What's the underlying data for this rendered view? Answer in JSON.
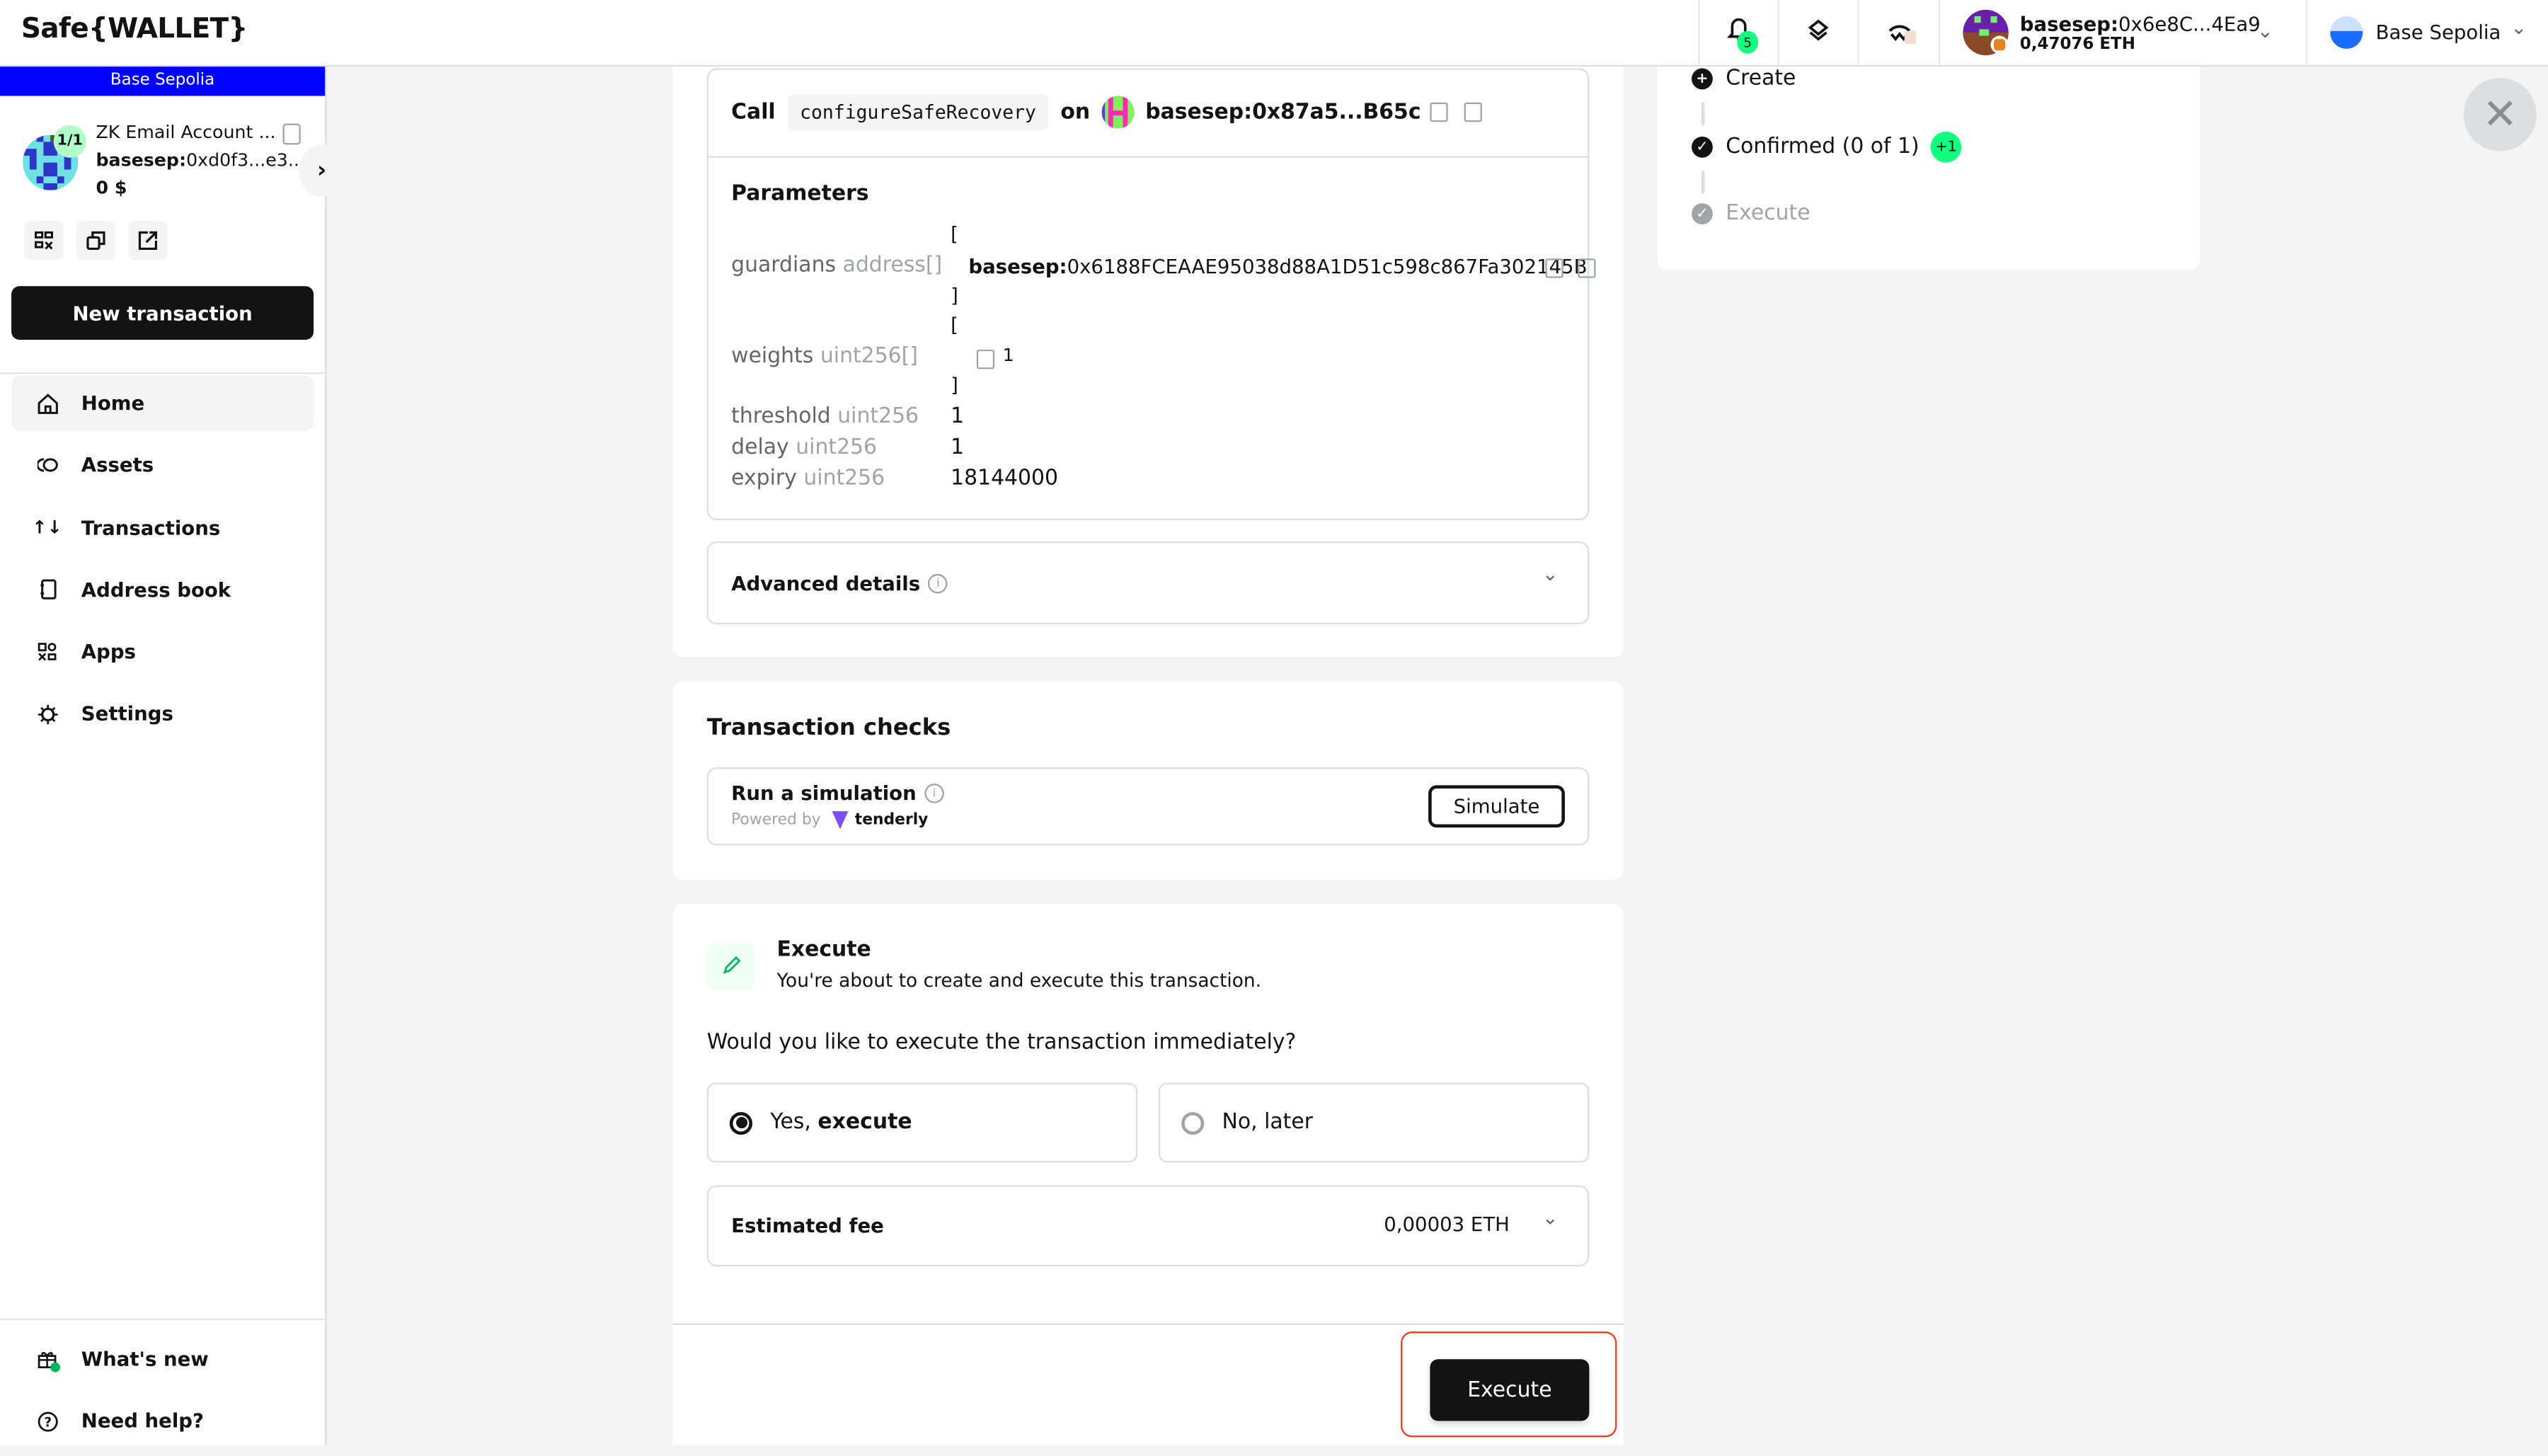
{
  "app": {
    "logo": "Safe{WALLET}"
  },
  "header": {
    "notifications_count": "5",
    "wallet": {
      "prefix": "basesep:",
      "address": "0x6e8C...4Ea9",
      "balance": "0,47076 ETH"
    },
    "network": "Base Sepolia"
  },
  "sidebar": {
    "network_banner": "Base Sepolia",
    "banner_color": "#0000ff",
    "safe": {
      "name": "ZK Email Account ...",
      "prefix": "basesep:",
      "address": "0xd0f3...e3...",
      "balance": "0 $",
      "threshold": "1/1"
    },
    "new_transaction": "New transaction",
    "nav": [
      {
        "label": "Home",
        "icon": "home-icon"
      },
      {
        "label": "Assets",
        "icon": "assets-icon"
      },
      {
        "label": "Transactions",
        "icon": "transactions-icon"
      },
      {
        "label": "Address book",
        "icon": "address-book-icon"
      },
      {
        "label": "Apps",
        "icon": "apps-icon"
      },
      {
        "label": "Settings",
        "icon": "settings-icon"
      }
    ],
    "bottom_nav": [
      {
        "label": "What's new",
        "icon": "gift-icon"
      },
      {
        "label": "Need help?",
        "icon": "help-icon"
      }
    ]
  },
  "tx": {
    "call_label": "Call",
    "method": "configureSafeRecovery",
    "on_label": "on",
    "contract_prefix": "basesep:",
    "contract_address": "0x87a5...B65c",
    "parameters_title": "Parameters",
    "params": {
      "guardians": {
        "name": "guardians",
        "type": "address[]",
        "open": "[",
        "close": "]",
        "value_prefix": "basesep:",
        "value": "0x6188FCEAAE95038d88A1D51c598c867Fa302145B"
      },
      "weights": {
        "name": "weights",
        "type": "uint256[]",
        "open": "[",
        "close": "]",
        "value": "1"
      },
      "threshold": {
        "name": "threshold",
        "type": "uint256",
        "value": "1"
      },
      "delay": {
        "name": "delay",
        "type": "uint256",
        "value": "1"
      },
      "expiry": {
        "name": "expiry",
        "type": "uint256",
        "value": "18144000"
      }
    },
    "advanced_details": "Advanced details"
  },
  "checks": {
    "title": "Transaction checks",
    "simulation_title": "Run a simulation",
    "powered_by": "Powered by",
    "provider": "tenderly",
    "simulate_button": "Simulate"
  },
  "execute": {
    "title": "Execute",
    "subtitle": "You're about to create and execute this transaction.",
    "question": "Would you like to execute the transaction immediately?",
    "option_yes_prefix": "Yes, ",
    "option_yes_bold": "execute",
    "option_no": "No, later",
    "selected": "yes",
    "fee_label": "Estimated fee",
    "fee_value": "0,00003 ETH",
    "button": "Execute"
  },
  "status": {
    "steps": [
      {
        "label": "Create",
        "state": "done"
      },
      {
        "label": "Confirmed (0 of 1)",
        "state": "done",
        "badge": "+1"
      },
      {
        "label": "Execute",
        "state": "pending"
      }
    ]
  }
}
